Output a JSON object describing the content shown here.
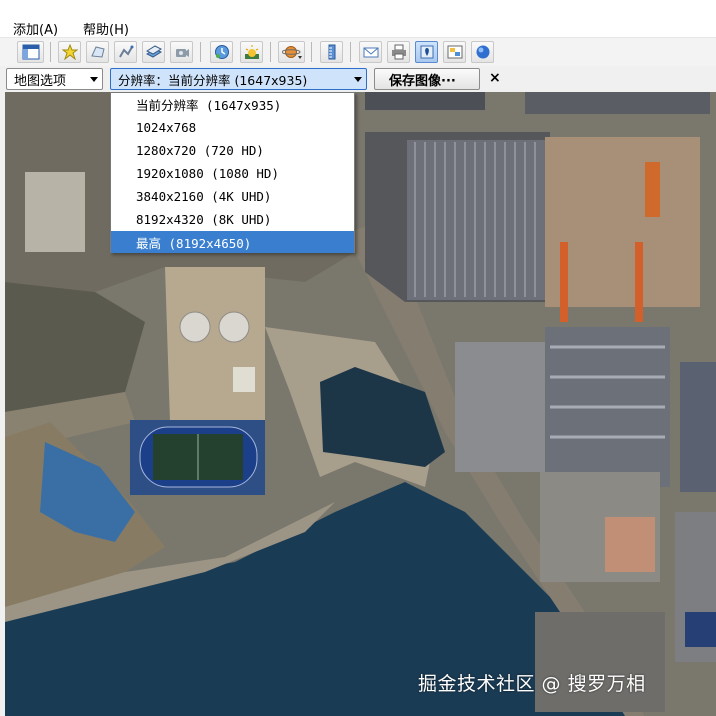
{
  "menu": {
    "add": "添加(A)",
    "help": "帮助(H)"
  },
  "toolbar": {
    "buttons": [
      "sidebar-toggle-icon",
      "add-placemark-icon",
      "add-polygon-icon",
      "add-path-icon",
      "add-overlay-icon",
      "record-tour-icon",
      "historical-imagery-icon",
      "sunlight-icon",
      "switch-planet-icon",
      "ruler-icon",
      "email-icon",
      "print-icon",
      "map-view-icon",
      "save-image-icon",
      "maps-icon"
    ]
  },
  "options": {
    "map_options": "地图选项",
    "resolution": "分辨率：当前分辨率 (1647x935)",
    "save_image": "保存图像···",
    "close": "×"
  },
  "dropdown": {
    "items": [
      "当前分辨率 (1647x935)",
      "1024x768",
      "1280x720 (720 HD)",
      "1920x1080 (1080 HD)",
      "3840x2160 (4K UHD)",
      "8192x4320 (8K UHD)",
      "最高 (8192x4650)"
    ],
    "selected_index": 6
  },
  "watermark": "掘金技术社区 @ 搜罗万相",
  "colors": {
    "accent": "#3a7fcf",
    "water": "#1d3a55",
    "field": "#2a4a7a"
  }
}
